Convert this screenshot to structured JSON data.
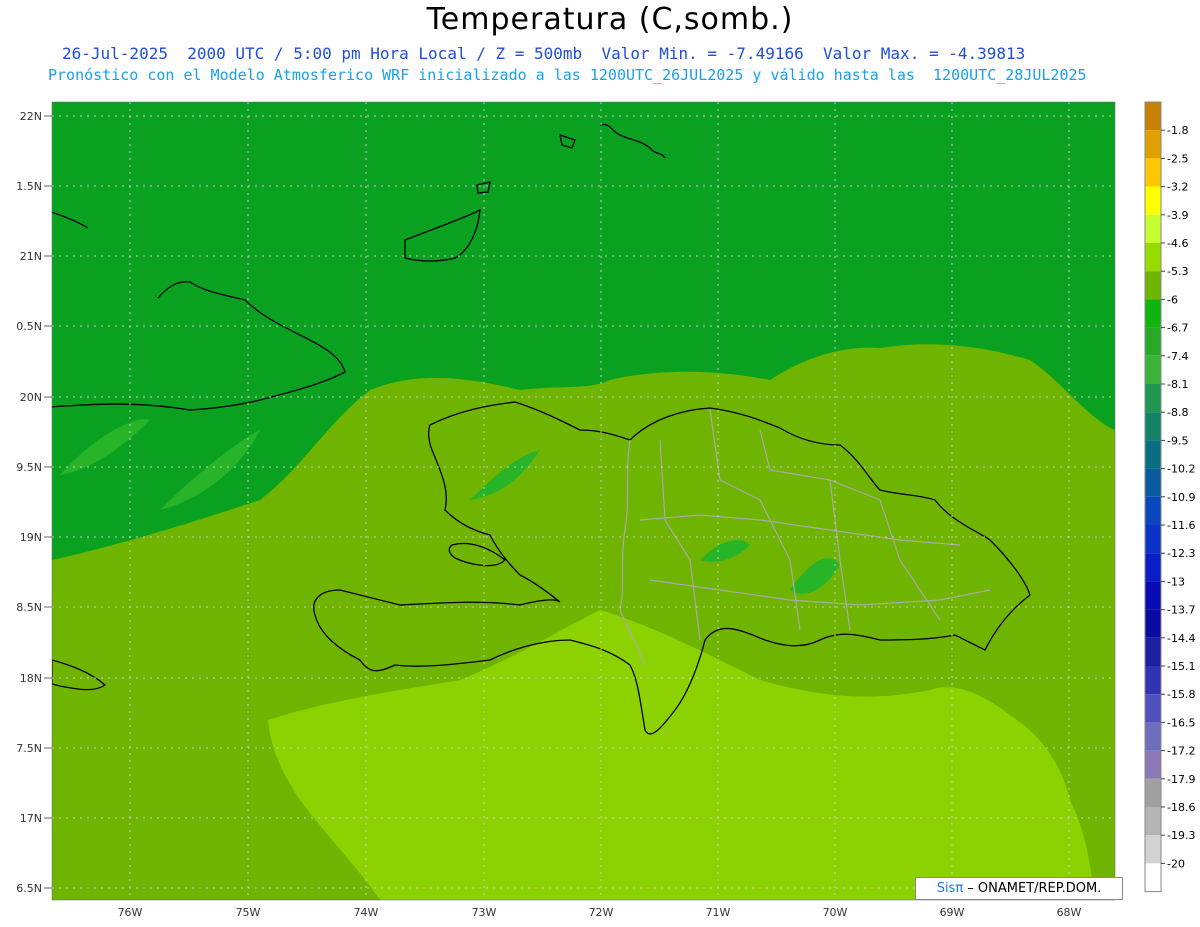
{
  "header": {
    "title": "Temperatura (C,somb.)",
    "line1": "26-Jul-2025  2000 UTC / 5:00 pm Hora Local / Z = 500mb  Valor Min. = -7.49166  Valor Max. = -4.39813",
    "line2": "Pronóstico con el Modelo Atmosferico WRF inicializado a las 1200UTC_26JUL2025 y válido hasta las  1200UTC_28JUL2025"
  },
  "map": {
    "lat_labels": [
      "22N",
      "1.5N",
      "21N",
      "0.5N",
      "20N",
      "9.5N",
      "19N",
      "8.5N",
      "18N",
      "7.5N",
      "17N",
      "6.5N"
    ],
    "lon_labels": [
      "76W",
      "75W",
      "74W",
      "73W",
      "72W",
      "71W",
      "70W",
      "69W",
      "68W"
    ],
    "colors": {
      "dark_green": "#0aa020",
      "mid_green": "#28b428",
      "olive_green": "#6eb400",
      "light_green": "#8cd200",
      "coast": "#000000",
      "borders": "#aaaaaa"
    }
  },
  "colorbar": {
    "labels": [
      "-1.8",
      "-2.5",
      "-3.2",
      "-3.9",
      "-4.6",
      "-5.3",
      "-6",
      "-6.7",
      "-7.4",
      "-8.1",
      "-8.8",
      "-9.5",
      "-10.2",
      "-10.9",
      "-11.6",
      "-12.3",
      "-13",
      "-13.7",
      "-14.4",
      "-15.1",
      "-15.8",
      "-16.5",
      "-17.2",
      "-17.9",
      "-18.6",
      "-19.3",
      "-20"
    ],
    "colors": [
      "#c88000",
      "#e0a000",
      "#ffc800",
      "#ffff00",
      "#c8ff32",
      "#96dc00",
      "#6eb400",
      "#0fb40f",
      "#28aa28",
      "#3cb43c",
      "#209650",
      "#148264",
      "#0a6e82",
      "#0a5aa0",
      "#0a46be",
      "#0a32c8",
      "#0a1ec8",
      "#0a0ab4",
      "#0a0aa0",
      "#1e1ea0",
      "#3232b4",
      "#5050be",
      "#6e6ebe",
      "#8c78b4",
      "#a0a0a0",
      "#b4b4b4",
      "#d2d2d2",
      "#ffffff"
    ]
  },
  "credit": {
    "sis": "Sisπ",
    "rest": " – ONAMET/REP.DOM."
  }
}
